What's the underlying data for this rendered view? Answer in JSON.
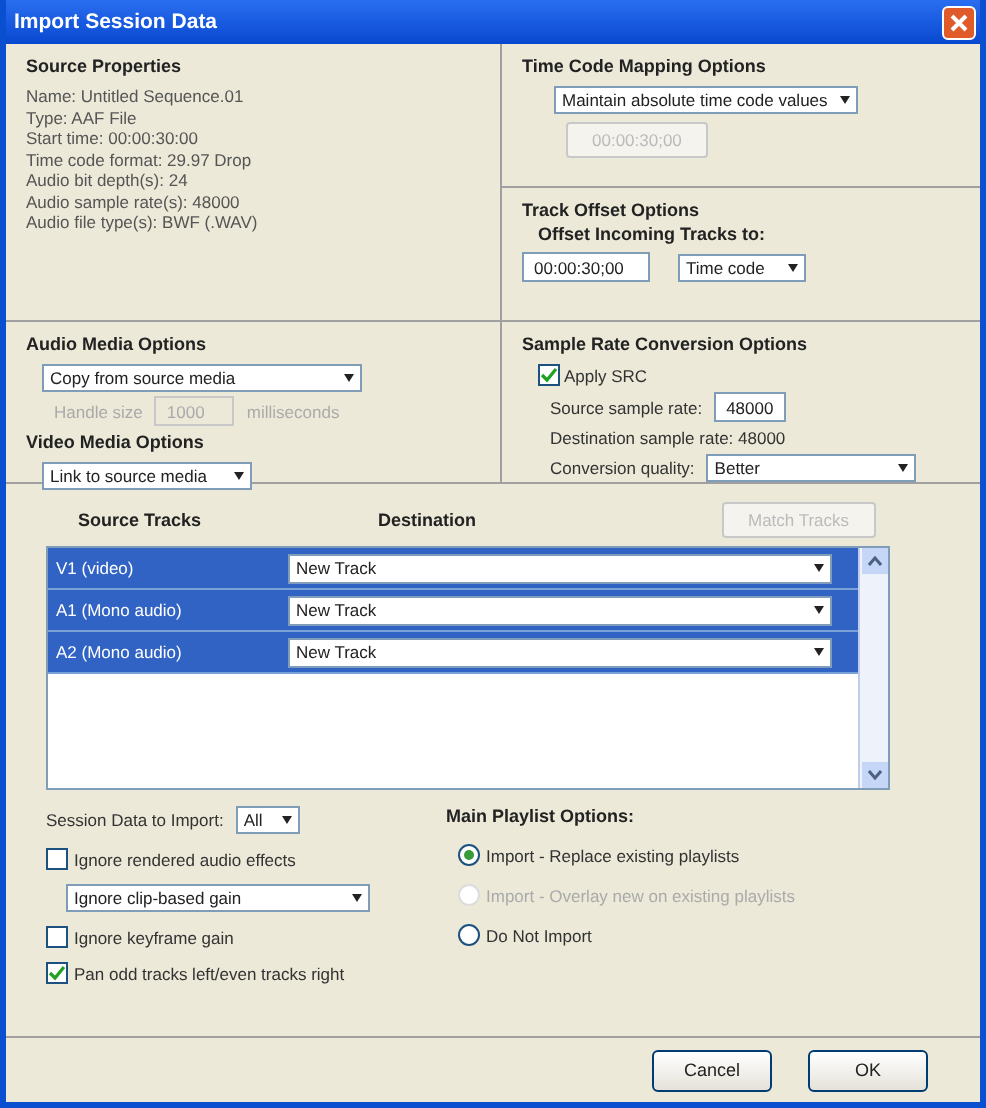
{
  "window": {
    "title": "Import Session Data"
  },
  "source_properties": {
    "title": "Source Properties",
    "lines": [
      "Name: Untitled Sequence.01",
      "Type: AAF File",
      "Start time: 00:00:30:00",
      "Time code format: 29.97 Drop",
      "Audio bit depth(s): 24",
      "Audio sample rate(s): 48000",
      "Audio file type(s): BWF (.WAV)"
    ]
  },
  "time_code_mapping": {
    "title": "Time Code Mapping Options",
    "mode": "Maintain absolute time code values",
    "timecode": "00:00:30;00",
    "timecode_disabled": true
  },
  "track_offset": {
    "title": "Track Offset Options",
    "label": "Offset Incoming Tracks to:",
    "value": "00:00:30;00",
    "unit": "Time code"
  },
  "audio_media": {
    "title": "Audio Media Options",
    "mode": "Copy from source media",
    "handle_label": "Handle size",
    "handle_value": "1000",
    "handle_unit": "milliseconds",
    "handle_disabled": true
  },
  "video_media": {
    "title": "Video Media Options",
    "mode": "Link to source media"
  },
  "sample_rate": {
    "title": "Sample Rate Conversion Options",
    "apply_src": {
      "label": "Apply SRC",
      "checked": true
    },
    "source_label": "Source sample rate:",
    "source_value": "48000",
    "destination": "Destination sample rate: 48000",
    "quality_label": "Conversion quality:",
    "quality": "Better"
  },
  "tracks": {
    "columns": [
      "Source Tracks",
      "Destination"
    ],
    "match_button": {
      "label": "Match Tracks",
      "disabled": true
    },
    "rows": [
      {
        "source": "V1 (video)",
        "destination": "New Track",
        "selected": true
      },
      {
        "source": "A1 (Mono audio)",
        "destination": "New Track",
        "selected": true
      },
      {
        "source": "A2 (Mono audio)",
        "destination": "New Track",
        "selected": true
      }
    ]
  },
  "session_data": {
    "label": "Session Data to Import:",
    "value": "All"
  },
  "options": [
    {
      "kind": "checkbox",
      "label": "Ignore rendered audio effects",
      "checked": false
    },
    {
      "kind": "dropdown",
      "label": "Ignore clip-based gain"
    },
    {
      "kind": "checkbox",
      "label": "Ignore keyframe gain",
      "checked": false
    },
    {
      "kind": "checkbox",
      "label": "Pan odd tracks left/even tracks right",
      "checked": true
    }
  ],
  "playlist": {
    "title": "Main Playlist Options:",
    "options": [
      {
        "label": "Import - Replace existing playlists",
        "selected": true,
        "disabled": false
      },
      {
        "label": "Import - Overlay new on existing playlists",
        "selected": false,
        "disabled": true
      },
      {
        "label": "Do Not Import",
        "selected": false,
        "disabled": false
      }
    ]
  },
  "buttons": [
    "Cancel",
    "OK"
  ]
}
